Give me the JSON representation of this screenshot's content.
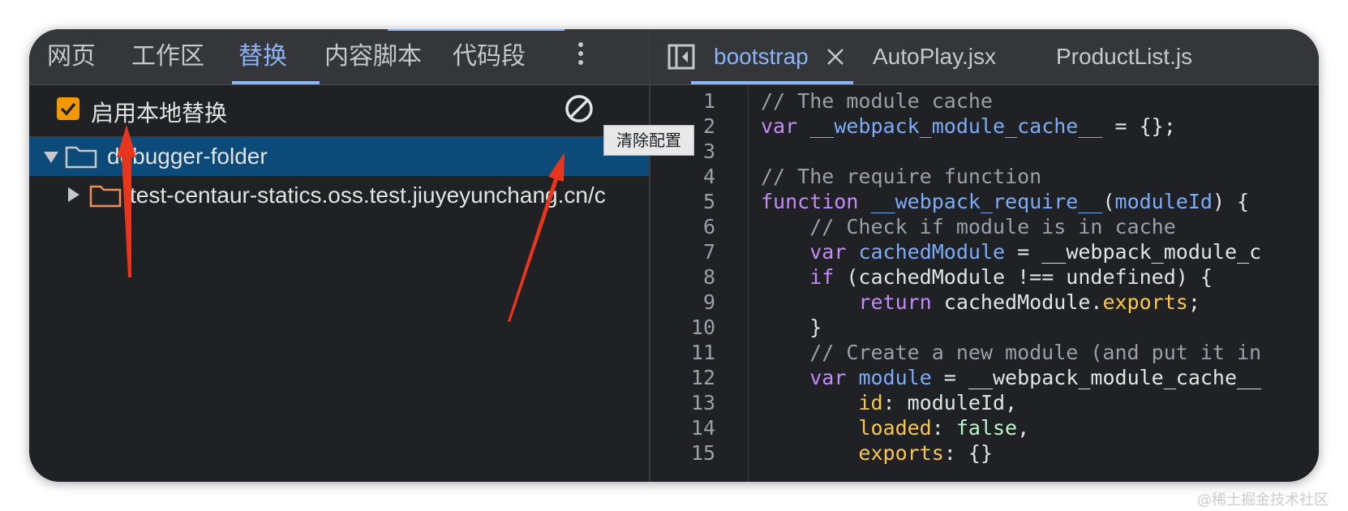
{
  "left_tabs": [
    "网页",
    "工作区",
    "替换",
    "内容脚本",
    "代码段"
  ],
  "toolbar": {
    "enable_label": "启用本地替换",
    "clear_tooltip": "清除配置"
  },
  "tree": {
    "root": "debugger-folder",
    "child": "test-centaur-statics.oss.test.jiuyeyunchang.cn/c"
  },
  "file_tabs": [
    "bootstrap",
    "AutoPlay.jsx",
    "ProductList.js"
  ],
  "editor": {
    "line_numbers": [
      "1",
      "2",
      "3",
      "4",
      "5",
      "6",
      "7",
      "8",
      "9",
      "10",
      "11",
      "12",
      "13",
      "14",
      "15"
    ],
    "lines": [
      [
        {
          "t": "// The module cache",
          "c": "comment"
        }
      ],
      [
        {
          "t": "var ",
          "c": "kw"
        },
        {
          "t": "__webpack_module_cache__",
          "c": "var"
        },
        {
          "t": " = {};",
          "c": "plain"
        }
      ],
      [],
      [
        {
          "t": "// The require function",
          "c": "comment"
        }
      ],
      [
        {
          "t": "function ",
          "c": "kw"
        },
        {
          "t": "__webpack_require__",
          "c": "var"
        },
        {
          "t": "(",
          "c": "plain"
        },
        {
          "t": "moduleId",
          "c": "var"
        },
        {
          "t": ") {",
          "c": "plain"
        }
      ],
      [
        {
          "t": "    // Check if module is in cache",
          "c": "comment"
        }
      ],
      [
        {
          "t": "    ",
          "c": "plain"
        },
        {
          "t": "var ",
          "c": "kw"
        },
        {
          "t": "cachedModule",
          "c": "var"
        },
        {
          "t": " = __webpack_module_c",
          "c": "plain"
        }
      ],
      [
        {
          "t": "    ",
          "c": "plain"
        },
        {
          "t": "if ",
          "c": "kw"
        },
        {
          "t": "(cachedModule !== undefined) {",
          "c": "plain"
        }
      ],
      [
        {
          "t": "        ",
          "c": "plain"
        },
        {
          "t": "return ",
          "c": "kw"
        },
        {
          "t": "cachedModule.",
          "c": "plain"
        },
        {
          "t": "exports",
          "c": "prop"
        },
        {
          "t": ";",
          "c": "plain"
        }
      ],
      [
        {
          "t": "    }",
          "c": "plain"
        }
      ],
      [
        {
          "t": "    // Create a new module (and put it in",
          "c": "comment"
        }
      ],
      [
        {
          "t": "    ",
          "c": "plain"
        },
        {
          "t": "var ",
          "c": "kw"
        },
        {
          "t": "module",
          "c": "var"
        },
        {
          "t": " = __webpack_module_cache__",
          "c": "plain"
        }
      ],
      [
        {
          "t": "        ",
          "c": "plain"
        },
        {
          "t": "id",
          "c": "prop"
        },
        {
          "t": ": moduleId,",
          "c": "plain"
        }
      ],
      [
        {
          "t": "        ",
          "c": "plain"
        },
        {
          "t": "loaded",
          "c": "prop"
        },
        {
          "t": ": ",
          "c": "plain"
        },
        {
          "t": "false",
          "c": "lit"
        },
        {
          "t": ",",
          "c": "plain"
        }
      ],
      [
        {
          "t": "        ",
          "c": "plain"
        },
        {
          "t": "exports",
          "c": "prop"
        },
        {
          "t": ": {}",
          "c": "plain"
        }
      ]
    ]
  },
  "watermark": "@稀土掘金技术社区",
  "colors": {
    "accent": "#8ab4f8",
    "checkbox": "#f29900",
    "selected_row": "#0b4a79",
    "annotation_arrow": "#e8361e"
  },
  "icons": [
    "more-vert-icon",
    "block-icon",
    "folder-icon",
    "sidebar-toggle-icon",
    "close-icon"
  ]
}
